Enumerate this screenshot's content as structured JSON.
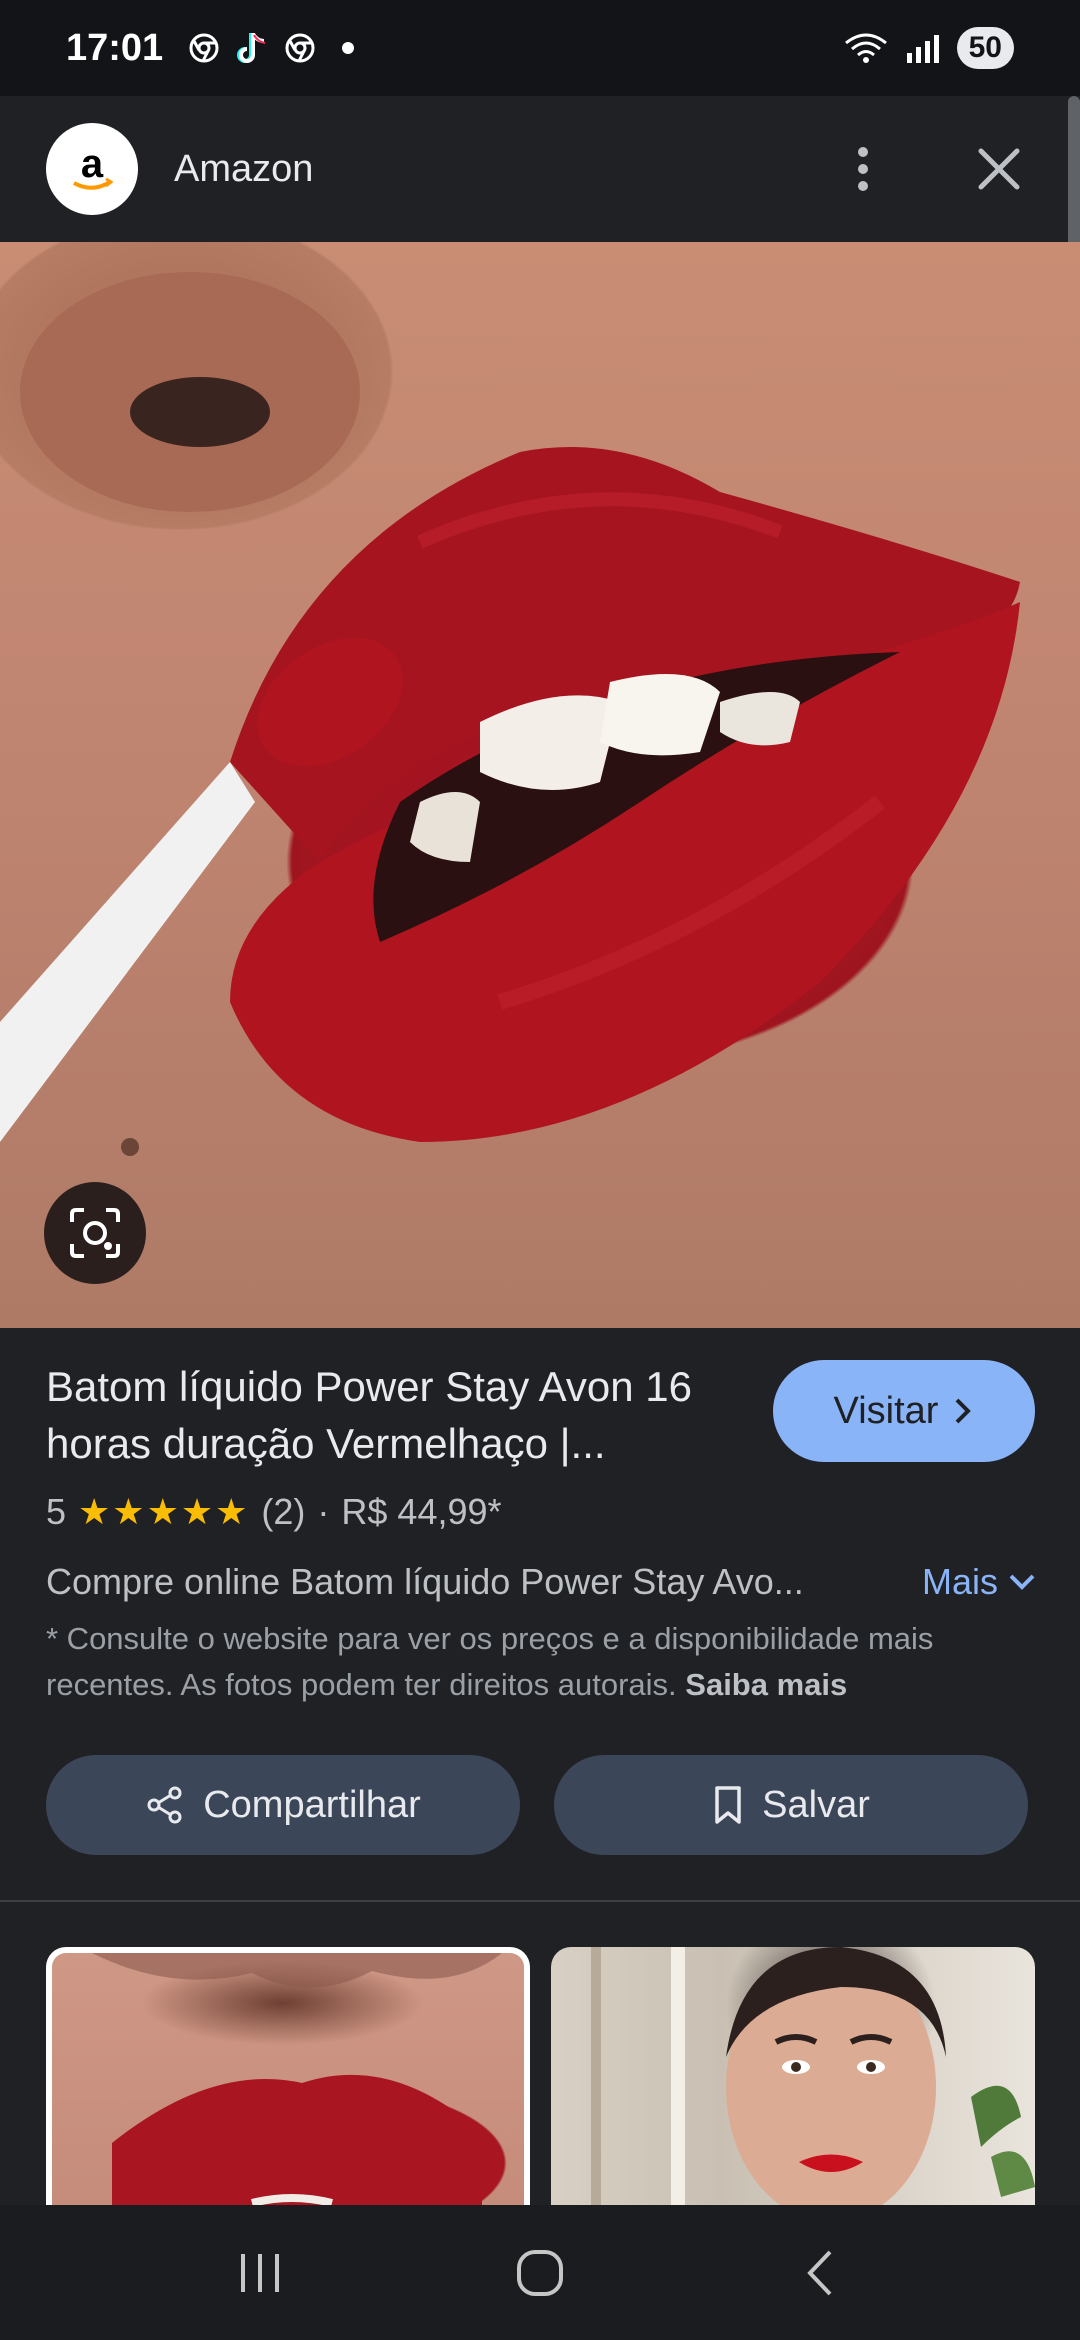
{
  "status_bar": {
    "time": "17:01",
    "battery": "50",
    "icons": [
      "chrome-icon",
      "tiktok-icon",
      "chrome-icon",
      "dot-icon",
      "wifi-icon",
      "signal-icon"
    ]
  },
  "header": {
    "site_name": "Amazon",
    "logo_letter": "a",
    "menu_icon": "more-vert-icon",
    "close_icon": "close-icon"
  },
  "product": {
    "title": "Batom líquido Power Stay Avon 16 horas duração Vermelhaço |...",
    "rating_value": "5",
    "stars": "★★★★★",
    "rating_count": "(2)",
    "separator": "·",
    "price": "R$ 44,99*",
    "description": "Compre online Batom líquido Power Stay Avo...",
    "more_label": "Mais",
    "disclaimer": "* Consulte o website para ver os preços e a disponibilidade mais recentes. As fotos podem ter direitos autorais.",
    "learn_more": "Saiba mais"
  },
  "buttons": {
    "visit": "Visitar",
    "share": "Compartilhar",
    "save": "Salvar"
  },
  "colors": {
    "accent": "#8ab4f8",
    "background": "#202124",
    "button_bg": "#3c4659",
    "star": "#fbbc04"
  }
}
